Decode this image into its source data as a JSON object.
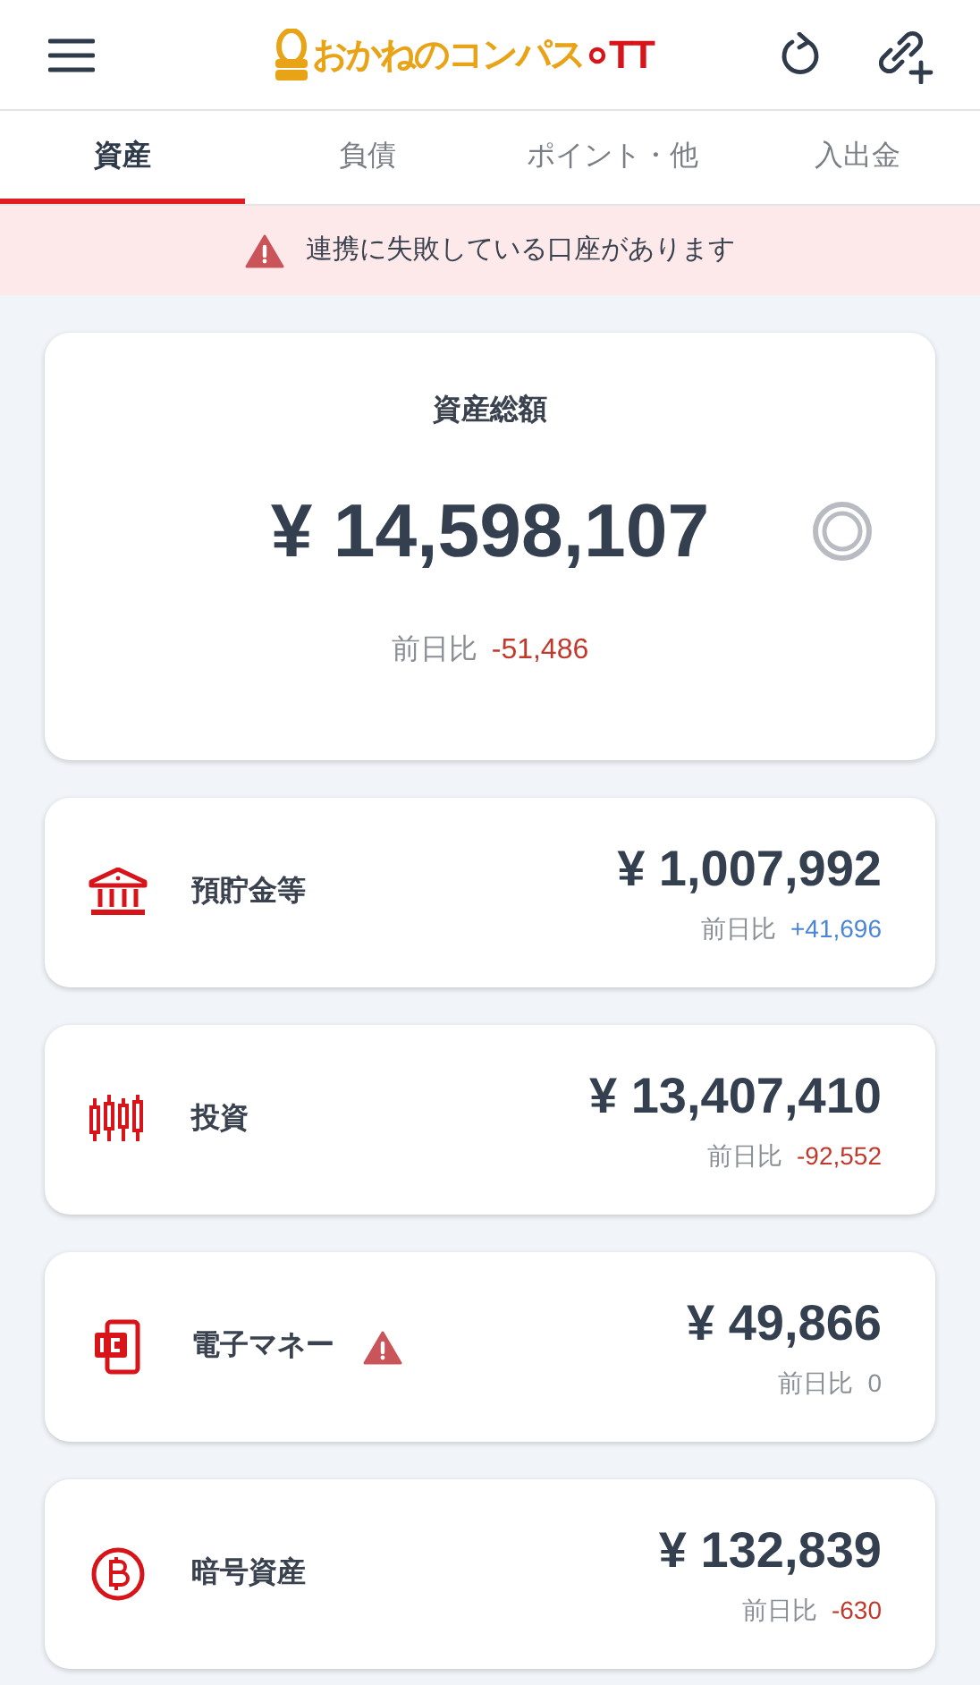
{
  "header": {
    "logo_text": "おかねのコンパス",
    "logo_suffix": "TT"
  },
  "tabs": [
    {
      "label": "資産",
      "selected": true
    },
    {
      "label": "負債",
      "selected": false
    },
    {
      "label": "ポイント・他",
      "selected": false
    },
    {
      "label": "入出金",
      "selected": false
    }
  ],
  "alert": {
    "text": "連携に失敗している口座があります"
  },
  "summary": {
    "title": "資産総額",
    "amount": "¥ 14,598,107",
    "change_label": "前日比",
    "change": "-51,486",
    "color": "#c0392b"
  },
  "categories": [
    {
      "kind": "bank",
      "label": "預貯金等",
      "warning": false,
      "amount": "¥ 1,007,992",
      "change_label": "前日比",
      "change": "+41,696",
      "color": "#4a86d8"
    },
    {
      "kind": "investment",
      "label": "投資",
      "warning": false,
      "amount": "¥ 13,407,410",
      "change_label": "前日比",
      "change": "-92,552",
      "color": "#c0392b"
    },
    {
      "kind": "emoney",
      "label": "電子マネー",
      "warning": true,
      "amount": "¥ 49,866",
      "change_label": "前日比",
      "change": "0",
      "color": "#8a8f96"
    },
    {
      "kind": "crypto",
      "label": "暗号資産",
      "warning": false,
      "amount": "¥ 132,839",
      "change_label": "前日比",
      "change": "-630",
      "color": "#c0392b"
    }
  ]
}
